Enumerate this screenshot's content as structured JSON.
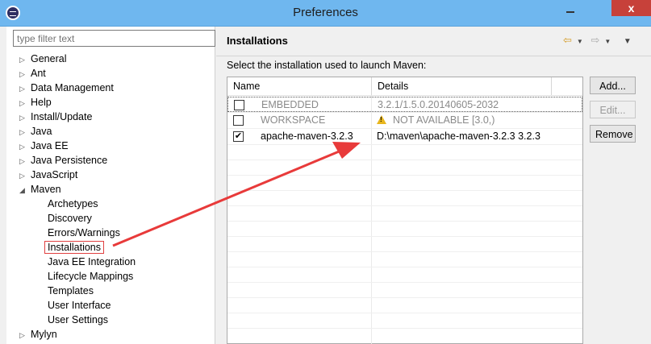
{
  "window": {
    "title": "Preferences",
    "close_label": "x"
  },
  "filter": {
    "placeholder": "type filter text"
  },
  "tree": {
    "items": [
      {
        "label": "General",
        "level": 0,
        "expander": "collapsed"
      },
      {
        "label": "Ant",
        "level": 0,
        "expander": "collapsed"
      },
      {
        "label": "Data Management",
        "level": 0,
        "expander": "collapsed"
      },
      {
        "label": "Help",
        "level": 0,
        "expander": "collapsed"
      },
      {
        "label": "Install/Update",
        "level": 0,
        "expander": "collapsed"
      },
      {
        "label": "Java",
        "level": 0,
        "expander": "collapsed"
      },
      {
        "label": "Java EE",
        "level": 0,
        "expander": "collapsed"
      },
      {
        "label": "Java Persistence",
        "level": 0,
        "expander": "collapsed"
      },
      {
        "label": "JavaScript",
        "level": 0,
        "expander": "collapsed"
      },
      {
        "label": "Maven",
        "level": 0,
        "expander": "expanded"
      },
      {
        "label": "Archetypes",
        "level": 1
      },
      {
        "label": "Discovery",
        "level": 1
      },
      {
        "label": "Errors/Warnings",
        "level": 1
      },
      {
        "label": "Installations",
        "level": 1,
        "selected": true
      },
      {
        "label": "Java EE Integration",
        "level": 1
      },
      {
        "label": "Lifecycle Mappings",
        "level": 1
      },
      {
        "label": "Templates",
        "level": 1
      },
      {
        "label": "User Interface",
        "level": 1
      },
      {
        "label": "User Settings",
        "level": 1
      },
      {
        "label": "Mylyn",
        "level": 0,
        "expander": "collapsed"
      }
    ]
  },
  "page": {
    "title": "Installations",
    "description": "Select the installation used to launch Maven:"
  },
  "table": {
    "columns": [
      "Name",
      "Details"
    ],
    "rows": [
      {
        "checked": false,
        "name": "EMBEDDED",
        "details": "3.2.1/1.5.0.20140605-2032",
        "disabled": true
      },
      {
        "checked": false,
        "name": "WORKSPACE",
        "details": "NOT AVAILABLE [3.0,)",
        "disabled": true,
        "warning": true
      },
      {
        "checked": true,
        "name": "apache-maven-3.2.3",
        "details": "D:\\maven\\apache-maven-3.2.3 3.2.3",
        "disabled": false
      }
    ]
  },
  "buttons": {
    "add": "Add...",
    "edit": "Edit...",
    "remove": "Remove"
  },
  "colors": {
    "titlebar": "#6fb7ef",
    "close": "#c7413a",
    "annotation": "#e83a3a"
  }
}
